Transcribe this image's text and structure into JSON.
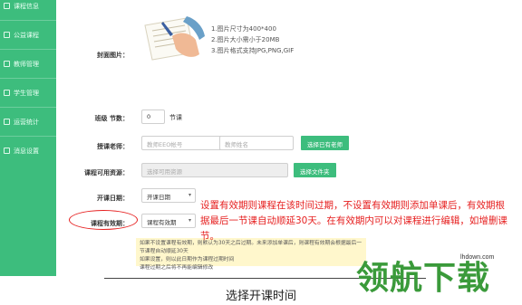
{
  "sidebar": {
    "items": [
      {
        "label": "课程信息"
      },
      {
        "label": "公益课程"
      },
      {
        "label": "教师管理"
      },
      {
        "label": "学生管理"
      },
      {
        "label": "运营统计"
      },
      {
        "label": "消息设置"
      }
    ]
  },
  "form": {
    "cover_label": "封面图片：",
    "cover_tips": [
      "1.图片尺寸为400*400",
      "2.图片大小需小于20MB",
      "3.图片格式支持JPG,PNG,GIF"
    ],
    "classes_label": "班级 节数：",
    "classes_value": "0",
    "classes_unit": "节课",
    "teacher_label": "授课老师：",
    "teacher_id_placeholder": "教师EEO帐号",
    "teacher_name_placeholder": "教师姓名",
    "teacher_button": "选择已有老师",
    "resource_label": "课程可用资源：",
    "resource_placeholder": "选择可用资源",
    "resource_button": "选择文件夹",
    "start_label": "开课日期：",
    "start_value": "开课日期",
    "validity_label": "课程有效期：",
    "validity_value": "课程有效期",
    "warn_lines": [
      "如果不设置课程有效期，则默认为30天之后过期。未来添加单课后，则课程有效期会根据最后一节课程自动顺延30天",
      "如果设置，则以此日期作为课程过期时间",
      "课程过期之后将不再能编辑修改"
    ]
  },
  "annotation": {
    "text": "设置有效期则课程在该时间过期，不设置有效期则添加单课后，有效期根据最后一节课自动顺延30天。在有效期内可以对课程进行编辑，如增删课节。",
    "color": "#e62020"
  },
  "caption": "选择开课时间",
  "watermark": {
    "brand": "领航下载",
    "url": "lhdown.com"
  },
  "colors": {
    "sidebar": "#3dbd7d",
    "button": "#3dbd7d"
  }
}
